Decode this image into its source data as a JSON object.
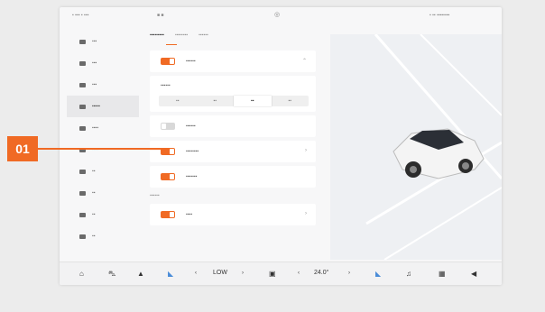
{
  "callout": {
    "label": "01",
    "color": "#f06a24"
  },
  "accent_color": "#f06a24",
  "dock": {
    "fan_level": "LOW",
    "temperature": "24.0°"
  },
  "dock_icons": [
    "home-icon",
    "car-icon",
    "hat-icon",
    "seat-icon",
    "chevron-left-icon",
    "chevron-right-icon",
    "fan-icon",
    "chevron-left-icon",
    "chevron-right-icon",
    "seat-heat-icon",
    "music-icon",
    "grid-icon",
    "volume-icon"
  ]
}
